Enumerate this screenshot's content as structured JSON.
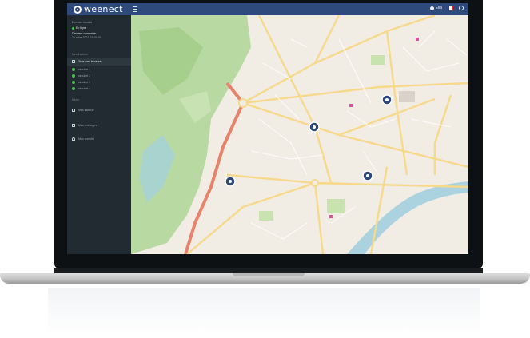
{
  "app": {
    "logo_text": "weenect"
  },
  "topbar": {
    "user_label": "Ella",
    "flag_colors": [
      "#1c3d8f",
      "#ffffff",
      "#d42a2a"
    ]
  },
  "sidebar": {
    "device_heading": "Derniere localite",
    "device_status": "En ligne",
    "last_seen_label": "Derniere connexion",
    "last_seen_value": "16 mars 2021 12:00:00",
    "trackers_section": "Mes trackers",
    "all_trackers_label": "Tous mes traceurs",
    "trackers": [
      {
        "label": "sécurité 1"
      },
      {
        "label": "sécurité 2"
      },
      {
        "label": "sécurité 3"
      },
      {
        "label": "sécurité 4"
      }
    ],
    "menu_section": "Menu",
    "menu": [
      {
        "label": "Mes traceurs",
        "icon": "tracker-icon"
      },
      {
        "label": "Mes recharges",
        "icon": "card-icon"
      },
      {
        "label": "Mon compte",
        "icon": "user-icon"
      }
    ]
  },
  "map": {
    "markers": [
      {
        "name": "tracker-marker-1"
      },
      {
        "name": "tracker-marker-2"
      },
      {
        "name": "tracker-marker-3"
      },
      {
        "name": "tracker-marker-4"
      }
    ]
  }
}
